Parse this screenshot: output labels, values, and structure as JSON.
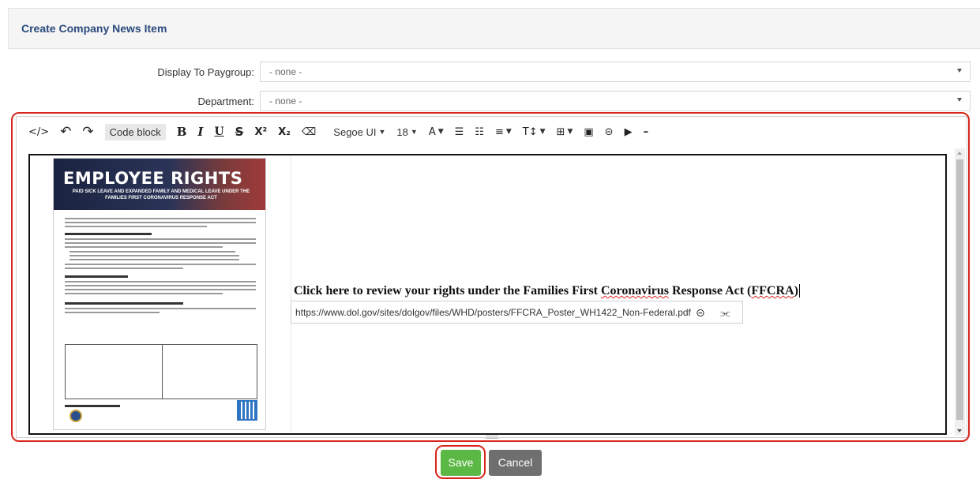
{
  "panel": {
    "title": "Create Company News Item"
  },
  "form": {
    "paygroup_label": "Display To Paygroup:",
    "paygroup_value": "- none -",
    "department_label": "Department:",
    "department_value": "- none -"
  },
  "toolbar": {
    "code_view": "</>",
    "undo": "↶",
    "redo": "↷",
    "code_block": "Code block",
    "bold": "B",
    "italic": "I",
    "underline": "U",
    "strikethrough": "S",
    "superscript": "X²",
    "subscript": "X₂",
    "clear_format": "⌫",
    "font_family": "Segoe UI",
    "font_size": "18",
    "font_color": "A",
    "bullet_list": "☰",
    "numbered_list": "☷",
    "align": "≡",
    "line_height": "T↕",
    "table": "⊞",
    "image": "▣",
    "link": "⊝",
    "video": "▶",
    "horizontal_rule": "–"
  },
  "poster": {
    "title": "EMPLOYEE RIGHTS",
    "subtitle": "PAID SICK LEAVE AND EXPANDED FAMILY AND MEDICAL LEAVE UNDER THE FAMILIES FIRST CORONAVIRUS RESPONSE ACT"
  },
  "content": {
    "link_text_1": "Click here to review your rights under the Families First ",
    "link_text_2": "Coronavirus",
    "link_text_3": " Response Act (",
    "link_text_4": "FFCRA",
    "link_text_5": ")",
    "link_url": "https://www.dol.gov/sites/dolgov/files/WHD/posters/FFCRA_Poster_WH1422_Non-Federal.pdf"
  },
  "buttons": {
    "save": "Save",
    "cancel": "Cancel"
  }
}
